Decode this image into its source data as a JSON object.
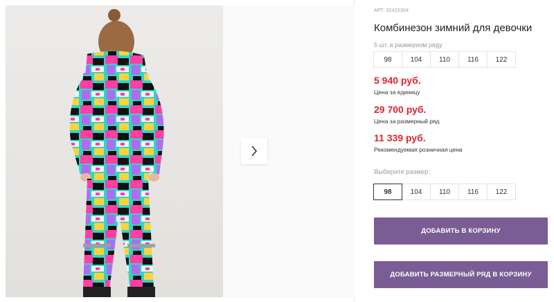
{
  "product": {
    "article": "АРТ. 32422304",
    "title": "Комбинезон зимний для девочки",
    "row_note": "5 шт. в размерном ряду",
    "row_sizes": [
      "98",
      "104",
      "110",
      "116",
      "122"
    ]
  },
  "prices": [
    {
      "value": "5 940 руб.",
      "label": "Цена за единицу"
    },
    {
      "value": "29 700 руб.",
      "label": "Цена за размерный ряд"
    },
    {
      "value": "11 339 руб.",
      "label": "Рекомендуемая розничная цена"
    }
  ],
  "size_picker": {
    "label": "Выберите размер:",
    "sizes": [
      "98",
      "104",
      "110",
      "116",
      "122"
    ],
    "selected": "98"
  },
  "buttons": {
    "add_to_cart": "Добавить в корзину",
    "add_row_to_cart": "Добавить размерный ряд в корзину"
  },
  "colors": {
    "price": "#e0242f",
    "button": "#7a5d94"
  }
}
